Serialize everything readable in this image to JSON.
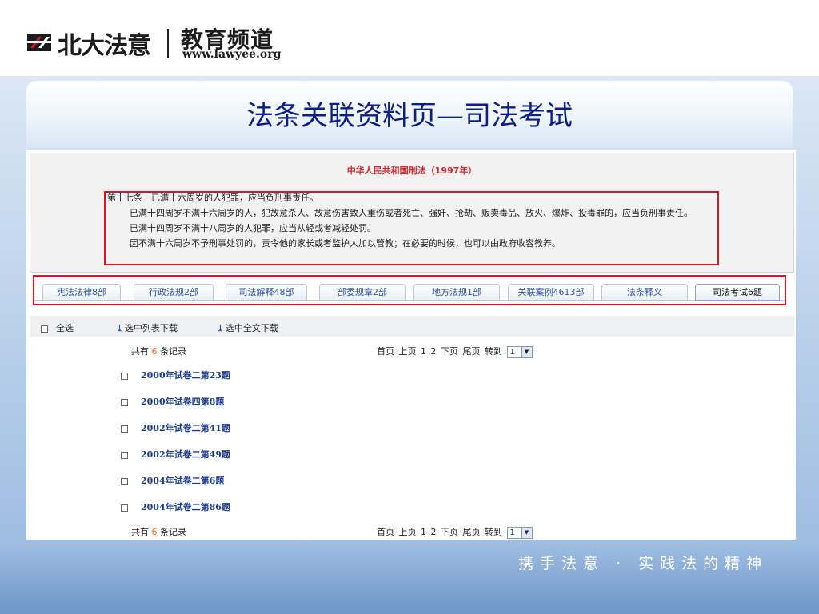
{
  "header": {
    "logo_cn": "北大法意",
    "channel": "教育频道",
    "url": "www.lawyee.org"
  },
  "banner": {
    "title": "法条关联资料页—司法考试"
  },
  "law": {
    "title": "中华人民共和国刑法（1997年）",
    "paragraphs": [
      "第十七条　已满十六周岁的人犯罪，应当负刑事责任。",
      "已满十四周岁不满十六周岁的人，犯故意杀人、故意伤害致人重伤或者死亡、强奸、抢劫、贩卖毒品、放火、爆炸、投毒罪的，应当负刑事责任。",
      "已满十四周岁不满十八周岁的人犯罪，应当从轻或者减轻处罚。",
      "因不满十六周岁不予刑事处罚的，责令他的家长或者监护人加以管教；在必要的时候，也可以由政府收容教养。"
    ]
  },
  "tabs": [
    {
      "label": "宪法法律8部"
    },
    {
      "label": "行政法规2部"
    },
    {
      "label": "司法解释48部"
    },
    {
      "label": "部委规章2部"
    },
    {
      "label": "地方法规1部"
    },
    {
      "label": "关联案例4613部"
    },
    {
      "label": "法条释义"
    },
    {
      "label": "司法考试6题"
    }
  ],
  "toolbar": {
    "select_all": "全选",
    "download_list": "选中列表下载",
    "download_full": "选中全文下载"
  },
  "records": {
    "prefix": "共有",
    "count": "6",
    "suffix": "条记录"
  },
  "pager": {
    "first": "首页",
    "prev": "上页",
    "page1": "1",
    "page2": "2",
    "next": "下页",
    "last": "尾页",
    "goto": "转到",
    "selected": "1"
  },
  "items": [
    "2000年试卷二第23题",
    "2000年试卷四第8题",
    "2002年试卷二第41题",
    "2002年试卷二第49题",
    "2004年试卷二第6题",
    "2004年试卷二第86题"
  ],
  "slogan": "携手法意 · 实践法的精神",
  "colors": {
    "title_blue": "#0b1f8a",
    "frame_red": "#d6191f",
    "link_blue": "#1a3c8f",
    "count_orange": "#ff6a00"
  }
}
